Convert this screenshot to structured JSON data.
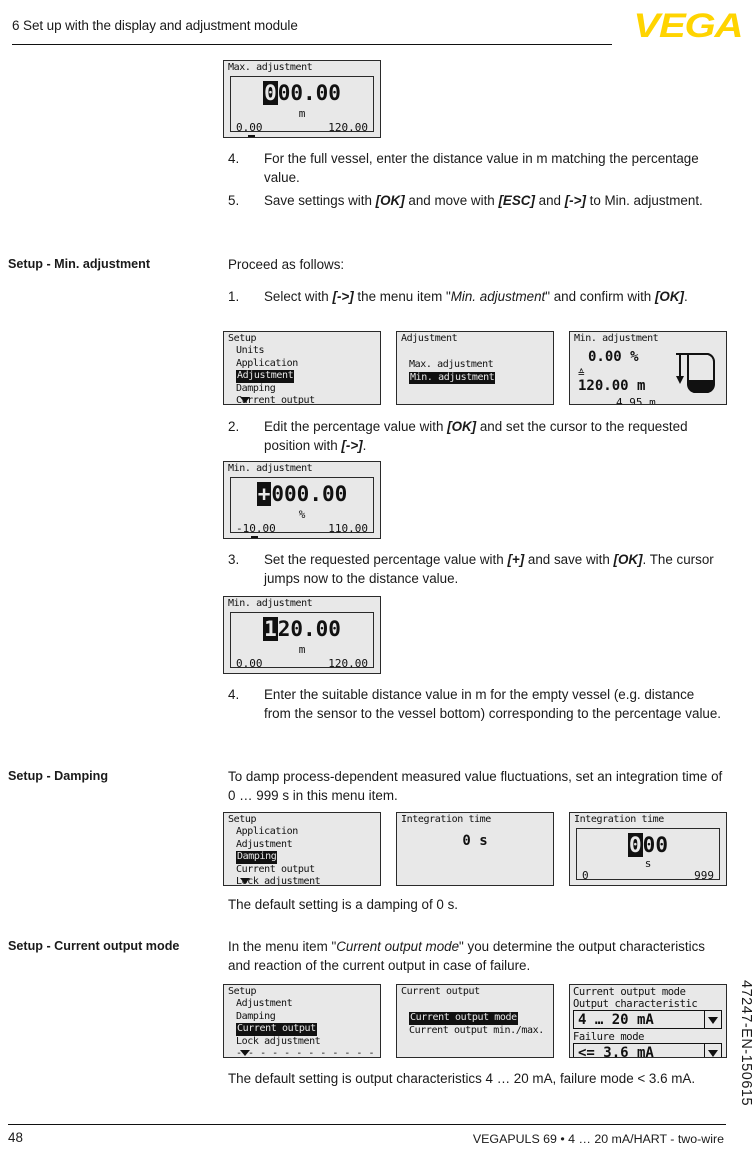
{
  "header": {
    "title": "6 Set up with the display and adjustment module",
    "logo": "VEGA"
  },
  "footer": {
    "page_number": "48",
    "document_line": "VEGAPULS 69 • 4 … 20 mA/HART - two-wire",
    "side_code": "47247-EN-150615"
  },
  "sections": {
    "max_adjustment": {
      "lcd": {
        "title": "Max. adjustment",
        "cursor_digit": "0",
        "rest_digits": "00.00",
        "unit": "m",
        "scale_low": "0.00",
        "scale_high": "120.00"
      },
      "steps": [
        {
          "num": "4.",
          "text_before": "For the full vessel, enter the distance value in m matching the percentage value."
        },
        {
          "num": "5.",
          "text_before": "Save settings with ",
          "k1": "[OK]",
          "mid1": " and move with ",
          "k2": "[ESC]",
          "mid2": " and ",
          "k3": "[->]",
          "after": " to Min. adjustment."
        }
      ]
    },
    "min_adjustment": {
      "marginal": "Setup - Min. adjustment",
      "intro": "Proceed as follows:",
      "step1": {
        "num": "1.",
        "a": "Select with ",
        "k1": "[->]",
        "b": " the menu item \"",
        "italic": "Min. adjustment",
        "c": "\" and confirm with ",
        "k2": "[OK]",
        "d": "."
      },
      "lcd_setup": {
        "root": "Setup",
        "items": [
          "Units",
          "Application",
          "Adjustment",
          "Damping",
          "Current output"
        ],
        "selected": "Adjustment",
        "has_down_arrow": true
      },
      "lcd_adjustment": {
        "root": "Adjustment",
        "items": [
          "Max. adjustment",
          "Min. adjustment"
        ],
        "selected": "Min. adjustment",
        "has_down_arrow": false
      },
      "lcd_summary": {
        "title": "Min. adjustment",
        "percent": "0.00 %",
        "equiv_symbol": "≙",
        "meters": "120.00 m",
        "distance": "4.95 m"
      },
      "step2": {
        "num": "2.",
        "a": "Edit the percentage value with ",
        "k1": "[OK]",
        "b": " and set the cursor to the requested position with ",
        "k2": "[->]",
        "c": "."
      },
      "lcd_percent": {
        "title": "Min. adjustment",
        "cursor_digit": "+",
        "rest_digits": "000.00",
        "unit": "%",
        "scale_low": "-10.00",
        "scale_high": "110.00"
      },
      "step3": {
        "num": "3.",
        "a": "Set the requested percentage value with ",
        "k1": "[+]",
        "b": " and save with ",
        "k2": "[OK]",
        "c": ". The cursor jumps now to the distance value."
      },
      "lcd_distance": {
        "title": "Min. adjustment",
        "cursor_digit": "1",
        "rest_digits": "20.00",
        "unit": "m",
        "scale_low": "0.00",
        "scale_high": "120.00"
      },
      "step4": {
        "num": "4.",
        "text": "Enter the suitable distance value in m for the empty vessel (e.g. distance from the sensor to the vessel bottom) corresponding to the percentage value."
      }
    },
    "damping": {
      "marginal": "Setup - Damping",
      "intro": "To damp process-dependent measured value fluctuations, set an integration time of 0 … 999 s in this menu item.",
      "lcd_setup": {
        "root": "Setup",
        "items": [
          "Application",
          "Adjustment",
          "Damping",
          "Current output",
          "Lock adjustment"
        ],
        "selected": "Damping",
        "has_down_arrow": true
      },
      "lcd_value": {
        "title": "Integration time",
        "value": "0 s"
      },
      "lcd_edit": {
        "title": "Integration time",
        "cursor_digit": "0",
        "rest_digits": "00",
        "unit": "s",
        "scale_low": "0",
        "scale_high": "999"
      },
      "note": "The default setting is a damping of 0 s."
    },
    "current_output_mode": {
      "marginal": "Setup - Current output mode",
      "intro_a": "In the menu item \"",
      "intro_italic": "Current output mode",
      "intro_b": "\" you determine the output characteristics and reaction of the current output in case of failure.",
      "lcd_setup": {
        "root": "Setup",
        "items": [
          "Adjustment",
          "Damping",
          "Current output",
          "Lock adjustment"
        ],
        "selected": "Current output",
        "separator": "- - - - - - - - - - - - - - - - - - - -",
        "has_down_arrow": true
      },
      "lcd_current_output": {
        "root": "Current output",
        "items": [
          "Current output mode",
          "Current output min./max."
        ],
        "selected": "Current output mode",
        "has_down_arrow": false
      },
      "lcd_mode": {
        "title": "Current output mode",
        "field1_label": "Output characteristic",
        "field1_value": "4 … 20 mA",
        "field2_label": "Failure mode",
        "field2_value": "<= 3.6 mA"
      },
      "note_a": "The default setting is output characteristics 4 … 20 mA, failure mode",
      "note_b": "< 3.6 mA."
    }
  }
}
